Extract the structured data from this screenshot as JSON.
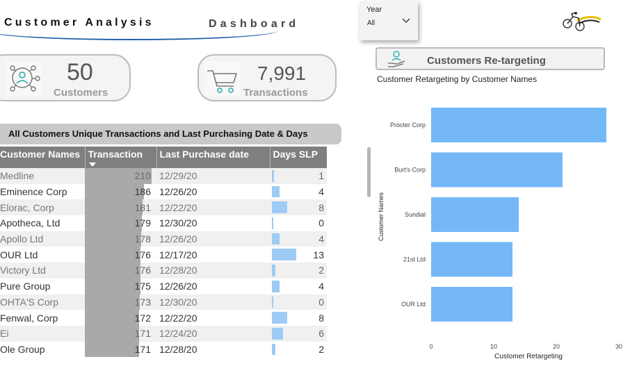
{
  "header": {
    "title_left": "Customer Analysis",
    "title_right": "Dashboard"
  },
  "slicer": {
    "label": "Year",
    "value": "All"
  },
  "kpis": {
    "customers": {
      "value": "50",
      "label": "Customers"
    },
    "transactions": {
      "value": "7,991",
      "label": "Transactions"
    }
  },
  "table": {
    "banner": "All Customers Unique Transactions and Last Purchasing Date & Days",
    "columns": [
      "Customer Names",
      "Transaction",
      "Last Purchase date",
      "Days SLP"
    ],
    "rows": [
      {
        "name": "Medline",
        "transaction": "210",
        "date": "12/29/20",
        "days": "1"
      },
      {
        "name": "Eminence Corp",
        "transaction": "186",
        "date": "12/26/20",
        "days": "4"
      },
      {
        "name": "Elorac, Corp",
        "transaction": "181",
        "date": "12/22/20",
        "days": "8"
      },
      {
        "name": "Apotheca, Ltd",
        "transaction": "179",
        "date": "12/30/20",
        "days": "0"
      },
      {
        "name": "Apollo Ltd",
        "transaction": "178",
        "date": "12/26/20",
        "days": "4"
      },
      {
        "name": "OUR Ltd",
        "transaction": "176",
        "date": "12/17/20",
        "days": "13"
      },
      {
        "name": "Victory Ltd",
        "transaction": "176",
        "date": "12/28/20",
        "days": "2"
      },
      {
        "name": "Pure Group",
        "transaction": "175",
        "date": "12/26/20",
        "days": "4"
      },
      {
        "name": "OHTA'S Corp",
        "transaction": "173",
        "date": "12/30/20",
        "days": "0"
      },
      {
        "name": "Fenwal, Corp",
        "transaction": "172",
        "date": "12/22/20",
        "days": "8"
      },
      {
        "name": "Ei",
        "transaction": "171",
        "date": "12/24/20",
        "days": "6"
      },
      {
        "name": "Ole Group",
        "transaction": "171",
        "date": "12/28/20",
        "days": "2"
      }
    ]
  },
  "retargeting": {
    "button_label": "Customers Re-targeting",
    "chart_title": "Customer Retargeting by Customer Names"
  },
  "colors": {
    "bar_blue": "#75b8f8",
    "slp_bar": "#9dcbf3",
    "tx_bar": "#a9a9a9",
    "header_gray": "#7f7f7f",
    "title_blue": "#1f5fa8",
    "kpi_teal": "#3fb6b0"
  },
  "chart_data": {
    "type": "bar",
    "orientation": "horizontal",
    "categories": [
      "Procter Corp",
      "Burt's Corp",
      "Sundial",
      "21st Ltd",
      "OUR Ltd"
    ],
    "values": [
      28,
      21,
      14,
      13,
      13
    ],
    "xlabel": "Customer Retargeting",
    "ylabel": "Customer Names",
    "xlim": [
      0,
      30
    ],
    "xticks": [
      "0",
      "10",
      "20",
      "30"
    ],
    "grid": false
  }
}
